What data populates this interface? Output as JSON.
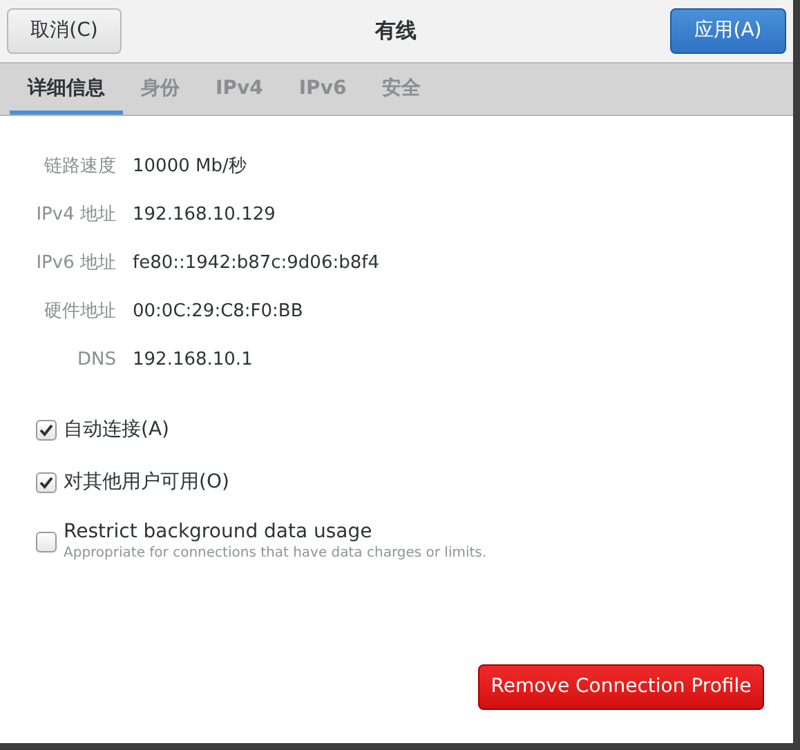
{
  "window": {
    "title": "有线",
    "cancel_button": "取消(C)",
    "apply_button": "应用(A)"
  },
  "tabs": [
    {
      "label": "详细信息",
      "selected": true
    },
    {
      "label": "身份",
      "selected": false
    },
    {
      "label": "IPv4",
      "selected": false
    },
    {
      "label": "IPv6",
      "selected": false
    },
    {
      "label": "安全",
      "selected": false
    }
  ],
  "details": [
    {
      "label": "链路速度",
      "value": "10000 Mb/秒"
    },
    {
      "label": "IPv4 地址",
      "value": "192.168.10.129"
    },
    {
      "label": "IPv6 地址",
      "value": "fe80::1942:b87c:9d06:b8f4"
    },
    {
      "label": "硬件地址",
      "value": "00:0C:29:C8:F0:BB"
    },
    {
      "label": "DNS",
      "value": "192.168.10.1"
    }
  ],
  "options": [
    {
      "label": "自动连接(A)",
      "checked": true
    },
    {
      "label": "对其他用户可用(O)",
      "checked": true
    },
    {
      "label": "Restrict background data usage",
      "hint": "Appropriate for connections that have data charges or limits.",
      "checked": false
    }
  ],
  "remove_button": "Remove Connection Profile"
}
